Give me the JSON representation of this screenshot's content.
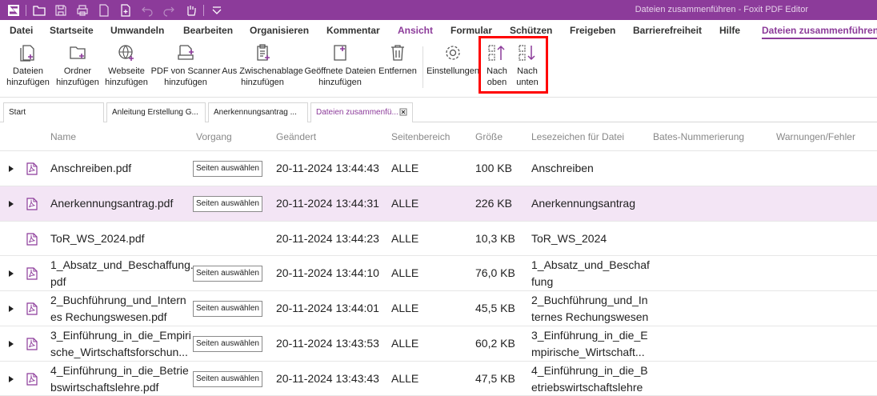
{
  "app": {
    "window_title": "Dateien zusammenführen - Foxit PDF Editor",
    "accent_color": "#8c3b9a"
  },
  "quick_access": [
    "folder-open-icon",
    "save-icon",
    "print-icon",
    "document-icon",
    "new-document-icon",
    "undo-icon",
    "redo-icon",
    "hand-tool-icon",
    "customize-dropdown-icon"
  ],
  "menu": [
    "Datei",
    "Startseite",
    "Umwandeln",
    "Bearbeiten",
    "Organisieren",
    "Kommentar",
    "Ansicht",
    "Formular",
    "Schützen",
    "Freigeben",
    "Barrierefreiheit",
    "Hilfe",
    "Dateien zusammenführen"
  ],
  "ribbon": {
    "add_files": [
      "Dateien",
      "hinzufügen"
    ],
    "add_folder": [
      "Ordner",
      "hinzufügen"
    ],
    "add_website": [
      "Webseite",
      "hinzufügen"
    ],
    "add_scanner": [
      "PDF von Scanner",
      "hinzufügen"
    ],
    "add_clipboard": [
      "Aus Zwischenablage",
      "hinzufügen"
    ],
    "add_open": [
      "Geöffnete Dateien",
      "hinzufügen"
    ],
    "remove": "Entfernen",
    "settings": "Einstellungen",
    "move_up": [
      "Nach",
      "oben"
    ],
    "move_down": [
      "Nach",
      "unten"
    ]
  },
  "doc_tabs": [
    "Start",
    "Anleitung Erstellung G...",
    "Anerkennungsantrag ...",
    "Dateien zusammenfü..."
  ],
  "table": {
    "headers": [
      "Name",
      "Vorgang",
      "Geändert",
      "Seitenbereich",
      "Größe",
      "Lesezeichen für Datei",
      "Bates-Nummerierung",
      "Warnungen/Fehler"
    ],
    "select_pages_label": "Seiten auswählen",
    "rows": [
      {
        "name": [
          "Anschreiben.pdf"
        ],
        "modified": "20-11-2024 13:44:43",
        "range": "ALLE",
        "size": "100 KB",
        "bookmark": [
          "Anschreiben"
        ],
        "has_children": true,
        "has_select": true,
        "selected": false
      },
      {
        "name": [
          "Anerkennungsantrag.pdf"
        ],
        "modified": "20-11-2024 13:44:31",
        "range": "ALLE",
        "size": "226 KB",
        "bookmark": [
          "Anerkennungsantrag"
        ],
        "has_children": true,
        "has_select": true,
        "selected": true
      },
      {
        "name": [
          "ToR_WS_2024.pdf"
        ],
        "modified": "20-11-2024 13:44:23",
        "range": "ALLE",
        "size": "10,3 KB",
        "bookmark": [
          "ToR_WS_2024"
        ],
        "has_children": false,
        "has_select": false,
        "selected": false
      },
      {
        "name": [
          "1_Absatz_und_Beschaffung.",
          "pdf"
        ],
        "modified": "20-11-2024 13:44:10",
        "range": "ALLE",
        "size": "76,0 KB",
        "bookmark": [
          "1_Absatz_und_Beschaf",
          "fung"
        ],
        "has_children": true,
        "has_select": true,
        "selected": false
      },
      {
        "name": [
          "2_Buchführung_und_Intern",
          "es Rechungswesen.pdf"
        ],
        "modified": "20-11-2024 13:44:01",
        "range": "ALLE",
        "size": "45,5 KB",
        "bookmark": [
          "2_Buchführung_und_In",
          "ternes Rechungswesen"
        ],
        "has_children": true,
        "has_select": true,
        "selected": false
      },
      {
        "name": [
          "3_Einführung_in_die_Empiri",
          "sche_Wirtschaftsforschun..."
        ],
        "modified": "20-11-2024 13:43:53",
        "range": "ALLE",
        "size": "60,2 KB",
        "bookmark": [
          "3_Einführung_in_die_E",
          "mpirische_Wirtschaft..."
        ],
        "has_children": true,
        "has_select": true,
        "selected": false
      },
      {
        "name": [
          "4_Einführung_in_die_Betrie",
          "bswirtschaftslehre.pdf"
        ],
        "modified": "20-11-2024 13:43:43",
        "range": "ALLE",
        "size": "47,5 KB",
        "bookmark": [
          "4_Einführung_in_die_B",
          "etriebswirtschaftslehre"
        ],
        "has_children": true,
        "has_select": true,
        "selected": false
      }
    ]
  }
}
